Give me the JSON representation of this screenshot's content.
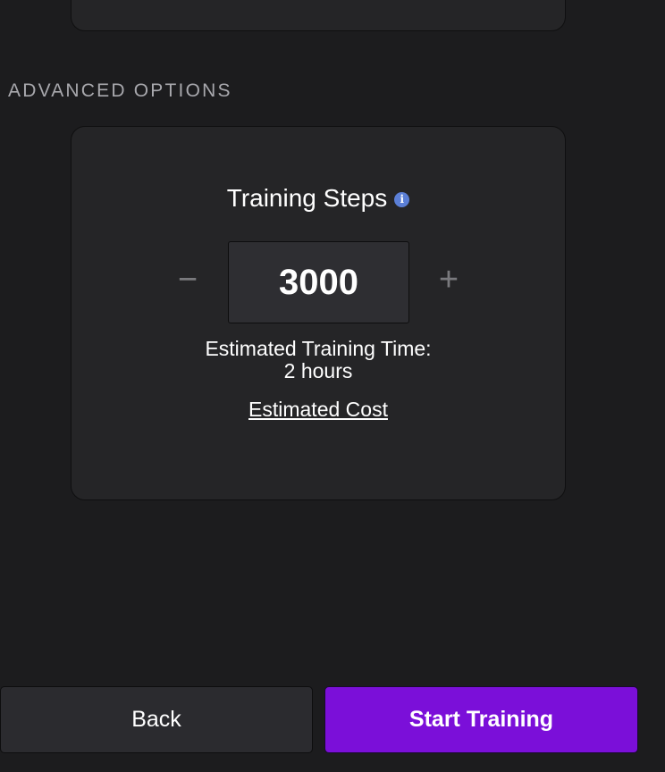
{
  "advanced_options": {
    "section_label": "ADVANCED OPTIONS",
    "training_steps": {
      "title": "Training Steps",
      "info_icon": "info-icon",
      "decrement_label": "−",
      "increment_label": "+",
      "value": "3000"
    },
    "estimated_time_label": "Estimated Training Time:",
    "estimated_time_value": "2 hours",
    "estimated_cost_link": "Estimated Cost"
  },
  "footer": {
    "back_label": "Back",
    "start_label": "Start Training"
  },
  "colors": {
    "background": "#1c1c1e",
    "card": "#252527",
    "accent": "#7b0fd9",
    "info": "#5b7fd6"
  }
}
